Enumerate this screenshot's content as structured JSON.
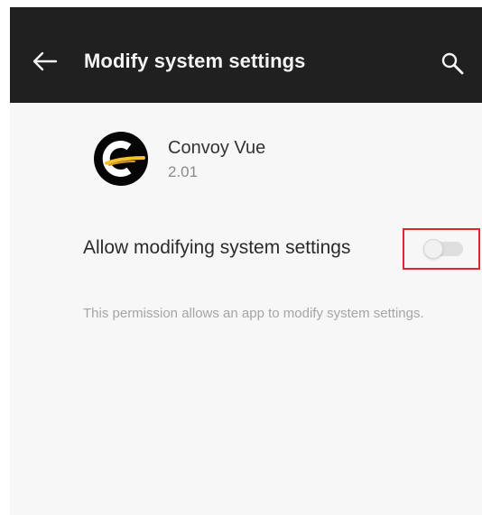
{
  "app_bar": {
    "title": "Modify system settings",
    "back_icon": "arrow-left-icon",
    "search_icon": "search-icon",
    "background_color": "#202020"
  },
  "app_info": {
    "name": "Convoy Vue",
    "version": "2.01",
    "logo_letter": "C",
    "logo_icon": "convoy-vue-logo"
  },
  "setting": {
    "label": "Allow modifying system settings",
    "toggle_state": false,
    "highlight_color": "#e1262d"
  },
  "description": "This permission allows an app to modify system settings."
}
